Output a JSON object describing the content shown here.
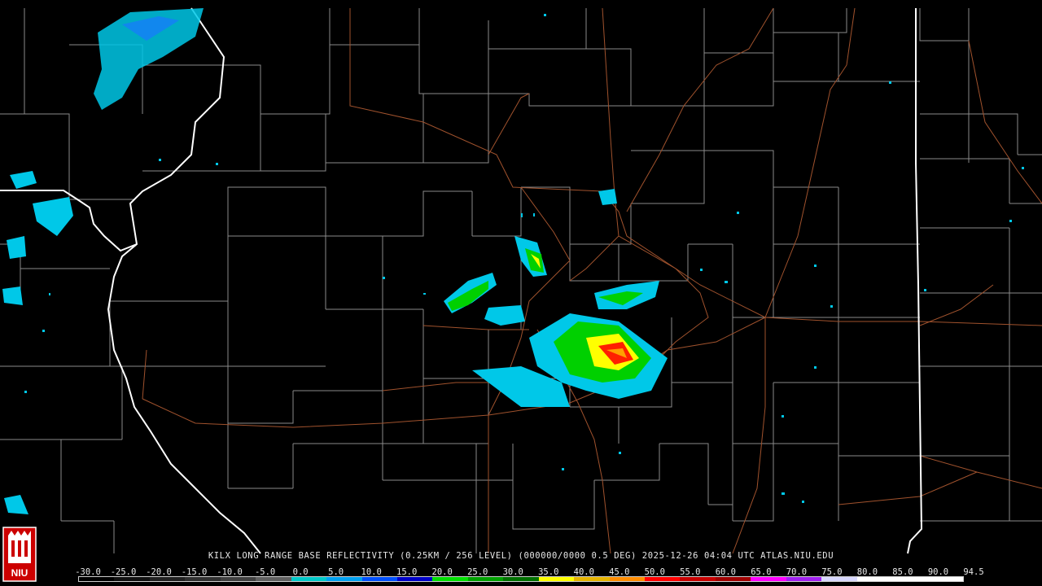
{
  "product": {
    "title": "KILX LONG RANGE BASE REFLECTIVITY (0.25KM / 256 LEVEL) (000000/0000 0.5 DEG) 2025-12-26 04:04 UTC  ATLAS.NIU.EDU",
    "station": "KILX",
    "timestamp": "2025-12-26 04:04 UTC",
    "source": "ATLAS.NIU.EDU"
  },
  "logo": {
    "text": "NIU",
    "name": "niu-logo"
  },
  "legend": {
    "labels": [
      "-30.0",
      "-25.0",
      "-20.0",
      "-15.0",
      "-10.0",
      "-5.0",
      "0.0",
      "5.0",
      "10.0",
      "15.0",
      "20.0",
      "25.0",
      "30.0",
      "35.0",
      "40.0",
      "45.0",
      "50.0",
      "55.0",
      "60.0",
      "65.0",
      "70.0",
      "75.0",
      "80.0",
      "85.0",
      "90.0",
      "94.5"
    ],
    "colors": [
      "#000000",
      "#101010",
      "#202020",
      "#303030",
      "#404040",
      "#606060",
      "#00c8c8",
      "#00a0f0",
      "#0050ff",
      "#0000c8",
      "#00e000",
      "#00a000",
      "#007000",
      "#ffff00",
      "#e6b400",
      "#ff8c00",
      "#ff0000",
      "#c80000",
      "#a00000",
      "#ff00ff",
      "#a020f0",
      "#d8d8ff",
      "#ffffff",
      "#ffffff",
      "#ffffff"
    ]
  },
  "colors": {
    "state_border": "#ffffff",
    "county_border": "#8a8a8a",
    "roads": "#a0522d",
    "echo_light": "#00c8e8",
    "echo_moderate": "#00d000",
    "echo_heavy": "#ffff00",
    "echo_intense": "#ff2000"
  }
}
